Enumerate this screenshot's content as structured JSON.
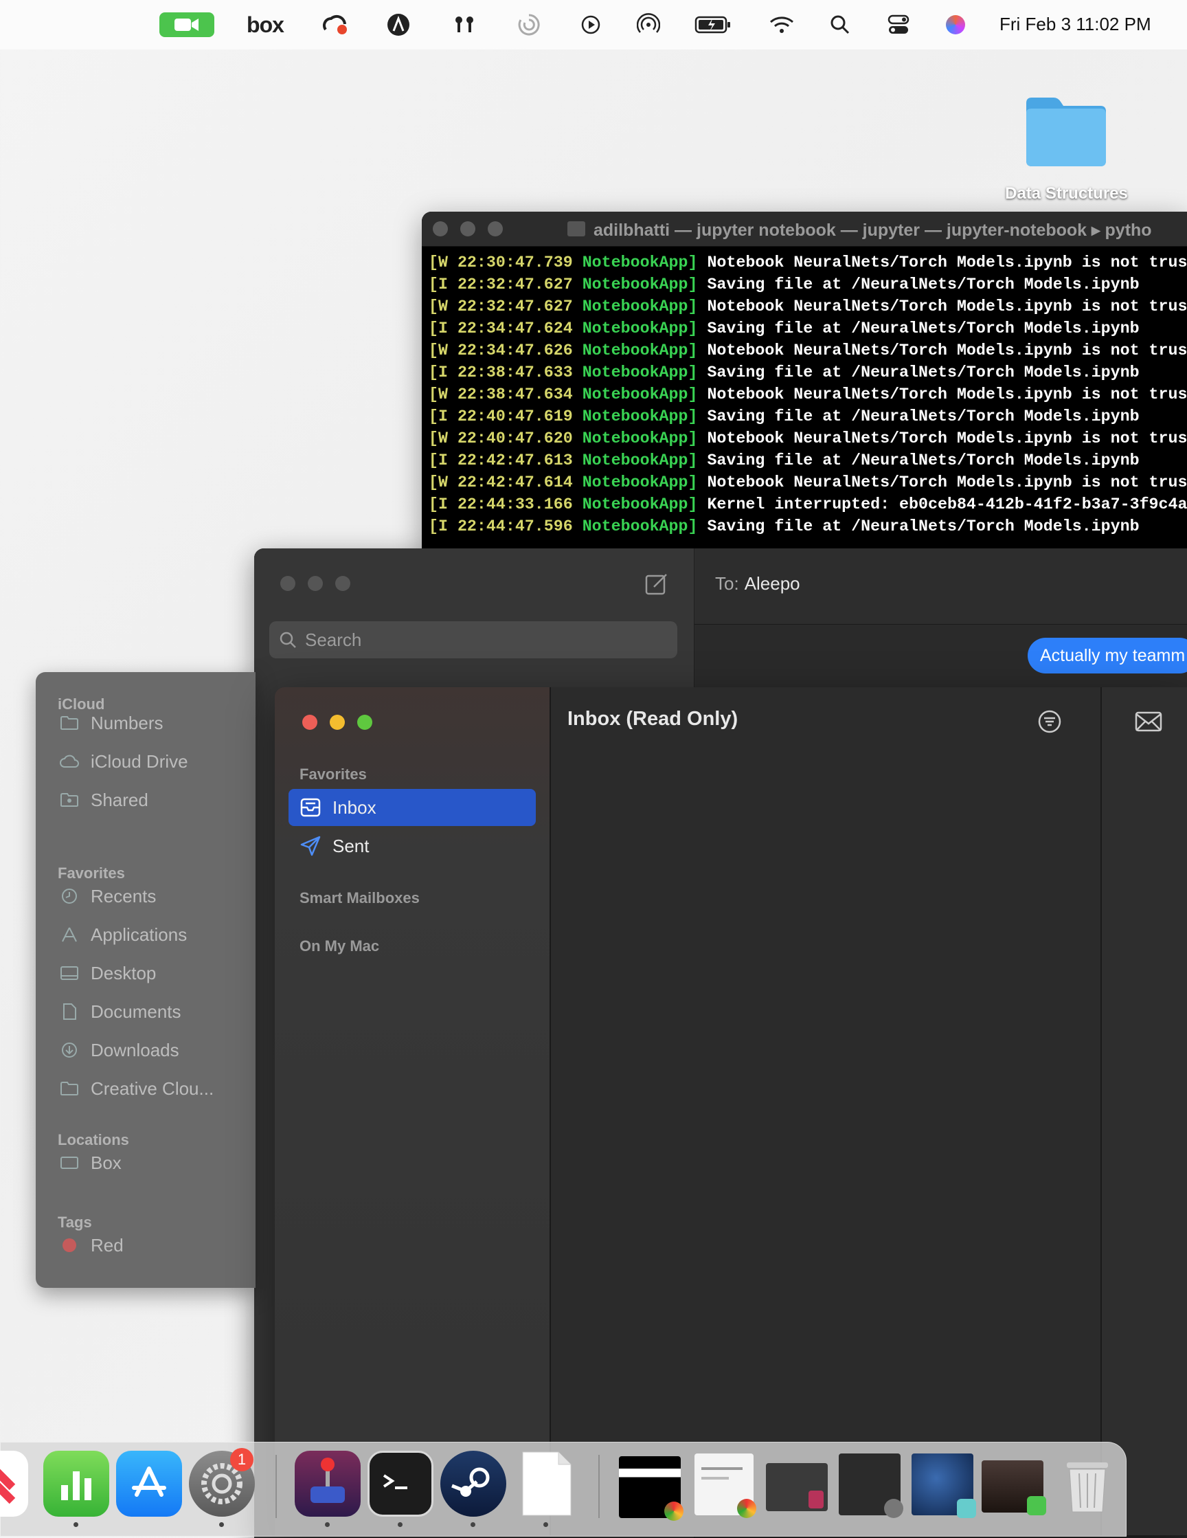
{
  "menubar": {
    "icons": [
      "facetime-icon",
      "box-icon",
      "creative-cloud-icon",
      "alfred-icon",
      "airpods-icon",
      "timing-icon",
      "play-icon",
      "airdrop-icon",
      "battery-icon",
      "wifi-icon",
      "spotlight-icon",
      "control-center-icon",
      "siri-icon"
    ],
    "box_label": "box",
    "clock": "Fri Feb 3  11:02 PM"
  },
  "desktop": {
    "folder_label": "Data Structures"
  },
  "terminal": {
    "title": "adilbhatti — jupyter notebook — jupyter — jupyter-notebook ▸ pytho",
    "lines": [
      {
        "tag": "[W 22:30:47.739",
        "app": "NotebookApp]",
        "msg": "Notebook NeuralNets/Torch Models.ipynb is not trus"
      },
      {
        "tag": "[I 22:32:47.627",
        "app": "NotebookApp]",
        "msg": "Saving file at /NeuralNets/Torch Models.ipynb"
      },
      {
        "tag": "[W 22:32:47.627",
        "app": "NotebookApp]",
        "msg": "Notebook NeuralNets/Torch Models.ipynb is not trus"
      },
      {
        "tag": "[I 22:34:47.624",
        "app": "NotebookApp]",
        "msg": "Saving file at /NeuralNets/Torch Models.ipynb"
      },
      {
        "tag": "[W 22:34:47.626",
        "app": "NotebookApp]",
        "msg": "Notebook NeuralNets/Torch Models.ipynb is not trus"
      },
      {
        "tag": "[I 22:38:47.633",
        "app": "NotebookApp]",
        "msg": "Saving file at /NeuralNets/Torch Models.ipynb"
      },
      {
        "tag": "[W 22:38:47.634",
        "app": "NotebookApp]",
        "msg": "Notebook NeuralNets/Torch Models.ipynb is not trus"
      },
      {
        "tag": "[I 22:40:47.619",
        "app": "NotebookApp]",
        "msg": "Saving file at /NeuralNets/Torch Models.ipynb"
      },
      {
        "tag": "[W 22:40:47.620",
        "app": "NotebookApp]",
        "msg": "Notebook NeuralNets/Torch Models.ipynb is not trus"
      },
      {
        "tag": "[I 22:42:47.613",
        "app": "NotebookApp]",
        "msg": "Saving file at /NeuralNets/Torch Models.ipynb"
      },
      {
        "tag": "[W 22:42:47.614",
        "app": "NotebookApp]",
        "msg": "Notebook NeuralNets/Torch Models.ipynb is not trus"
      },
      {
        "tag": "[I 22:44:33.166",
        "app": "NotebookApp]",
        "msg": "Kernel interrupted: eb0ceb84-412b-41f2-b3a7-3f9c4a"
      },
      {
        "tag": "[I 22:44:47.596",
        "app": "NotebookApp]",
        "msg": "Saving file at /NeuralNets/Torch Models.ipynb"
      }
    ]
  },
  "messages": {
    "search_placeholder": "Search",
    "to_label": "To:",
    "to_value": "Aleepo",
    "bubble": "Actually my teamm"
  },
  "finder": {
    "sections": [
      {
        "heading": "iCloud",
        "items": [
          {
            "label": "Numbers",
            "icon": "folder-icon"
          },
          {
            "label": "iCloud Drive",
            "icon": "cloud-icon"
          },
          {
            "label": "Shared",
            "icon": "shared-folder-icon"
          }
        ]
      },
      {
        "heading": "Favorites",
        "items": [
          {
            "label": "Recents",
            "icon": "clock-icon"
          },
          {
            "label": "Applications",
            "icon": "applications-icon"
          },
          {
            "label": "Desktop",
            "icon": "desktop-icon"
          },
          {
            "label": "Documents",
            "icon": "document-icon"
          },
          {
            "label": "Downloads",
            "icon": "download-icon"
          },
          {
            "label": "Creative Clou...",
            "icon": "folder-icon"
          }
        ]
      },
      {
        "heading": "Locations",
        "items": [
          {
            "label": "Box",
            "icon": "box-drive-icon"
          }
        ]
      },
      {
        "heading": "Tags",
        "items": [
          {
            "label": "Red",
            "icon": "red-tag-icon"
          }
        ]
      }
    ]
  },
  "mail": {
    "favorites_heading": "Favorites",
    "inbox_label": "Inbox",
    "sent_label": "Sent",
    "smart_heading": "Smart Mailboxes",
    "onmymac_heading": "On My Mac",
    "list_title": "Inbox (Read Only)"
  },
  "dock": {
    "badge_count": "1",
    "apps": [
      "news-icon",
      "numbers-icon",
      "app-store-icon",
      "system-settings-icon",
      "joystick-app-icon",
      "terminal-icon",
      "steam-icon",
      "document-icon",
      "chrome-window-thumb-1",
      "chrome-window-thumb-2",
      "system-settings-thumb",
      "maps-thumb",
      "facetime-thumb",
      "trash-icon"
    ]
  },
  "colors": {
    "accent_blue": "#2857c9",
    "bubble_blue": "#2d7ff9",
    "terminal_green": "#39d353",
    "terminal_yellow": "#d6d66a",
    "close_red": "#ee5f57",
    "minimize_yellow": "#f4bd2f",
    "zoom_green": "#5fc83f"
  }
}
